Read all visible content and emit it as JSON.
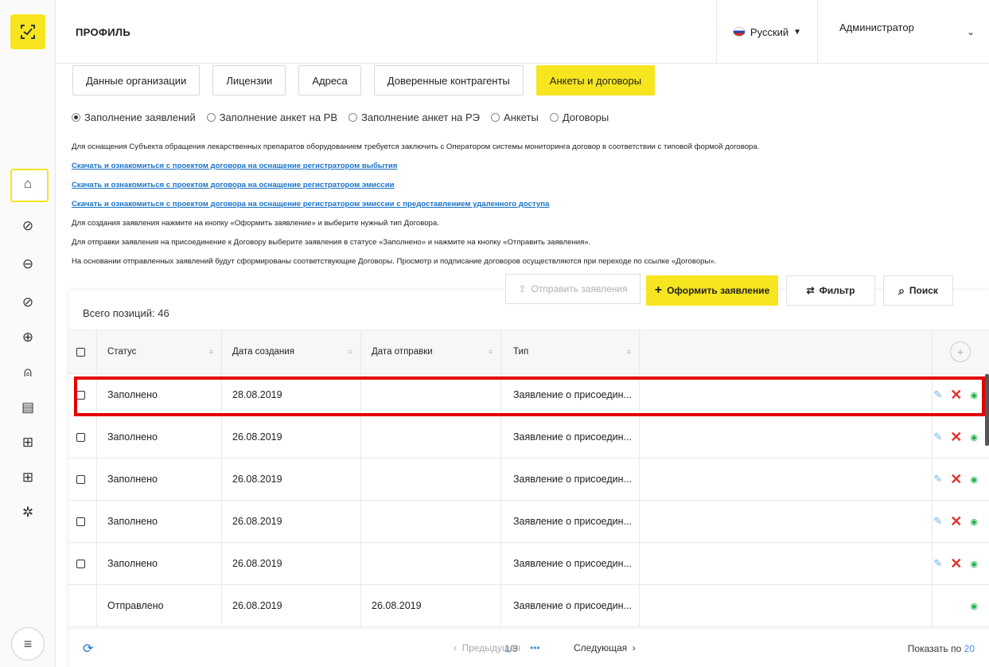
{
  "header": {
    "title": "ПРОФИЛЬ",
    "language": "Русский",
    "user": "Администратор"
  },
  "tabs": [
    {
      "label": "Данные организации"
    },
    {
      "label": "Лицензии"
    },
    {
      "label": "Адреса"
    },
    {
      "label": "Доверенные контрагенты"
    },
    {
      "label": "Анкеты и договоры"
    }
  ],
  "radios": [
    {
      "label": "Заполнение заявлений",
      "checked": true
    },
    {
      "label": "Заполнение анкет на РВ"
    },
    {
      "label": "Заполнение анкет на РЭ"
    },
    {
      "label": "Анкеты"
    },
    {
      "label": "Договоры"
    }
  ],
  "info": {
    "line1": "Для оснащения Субъекта обращения лекарственных препаратов оборудованием требуется заключить с Оператором системы мониторинга договор в соответствии с типовой формой договора.",
    "link1": "Скачать и ознакомиться с проектом договора на оснащение регистратором выбытия",
    "link2": "Скачать и ознакомиться с проектом договора на оснащение регистратором эмиссии",
    "link3": "Скачать и ознакомиться с проектом договора на оснащение регистратором эмиссии с предоставлением удаленного доступа",
    "line2": "Для создания заявления нажмите на кнопку «Оформить заявление» и выберите нужный тип Договора.",
    "line3": "Для отправки заявления на присоединение к Договору выберите заявления в статусе «Заполнено» и нажмите на кнопку «Отправить заявления».",
    "line4": "На основании отправленных заявлений будут сформированы соответствующие Договоры. Просмотр и подписание договоров осуществляются при переходе по ссылке «Договоры»."
  },
  "toolbar": {
    "send": "Отправить заявления",
    "create": "Оформить заявление",
    "filter": "Фильтр",
    "search": "Поиск"
  },
  "table": {
    "total": "Всего позиций: 46",
    "columns": [
      "Статус",
      "Дата создания",
      "Дата отправки",
      "Тип"
    ],
    "rows": [
      {
        "status": "Заполнено",
        "created": "28.08.2019",
        "sent": "",
        "type": "Заявление о присоедин..."
      },
      {
        "status": "Заполнено",
        "created": "26.08.2019",
        "sent": "",
        "type": "Заявление о присоедин..."
      },
      {
        "status": "Заполнено",
        "created": "26.08.2019",
        "sent": "",
        "type": "Заявление о присоедин..."
      },
      {
        "status": "Заполнено",
        "created": "26.08.2019",
        "sent": "",
        "type": "Заявление о присоедин..."
      },
      {
        "status": "Заполнено",
        "created": "26.08.2019",
        "sent": "",
        "type": "Заявление о присоедин..."
      },
      {
        "status": "Отправлено",
        "created": "26.08.2019",
        "sent": "26.08.2019",
        "type": "Заявление о присоедин..."
      }
    ]
  },
  "pager": {
    "prev": "Предыдущая",
    "page": "1",
    "of": "/3",
    "dots": "•••",
    "next": "Следующая",
    "show_label": "Показать по",
    "show_value": "20"
  },
  "colors": {
    "accent": "#f6e51f",
    "link": "#1a73c8",
    "highlight": "#e60000"
  }
}
